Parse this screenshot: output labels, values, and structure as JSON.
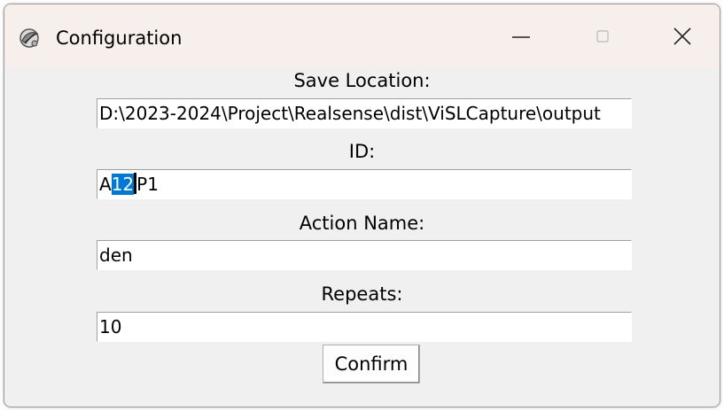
{
  "window": {
    "title": "Configuration",
    "icon": "feather-icon",
    "controls": {
      "minimize": "minimize-icon",
      "maximize": "maximize-icon",
      "close": "close-icon"
    }
  },
  "form": {
    "save_location": {
      "label": "Save Location:",
      "value": "D:\\2023-2024\\Project\\Realsense\\dist\\ViSLCapture\\output"
    },
    "id": {
      "label": "ID:",
      "value_prefix": "A",
      "value_selected": "12",
      "value_suffix": "P1"
    },
    "action_name": {
      "label": "Action Name:",
      "value": "den"
    },
    "repeats": {
      "label": "Repeats:",
      "value": "10"
    },
    "confirm_label": "Confirm"
  },
  "colors": {
    "selection": "#0078d7",
    "titlebar": "#f7efec",
    "window_bg": "#f0f0f0"
  }
}
